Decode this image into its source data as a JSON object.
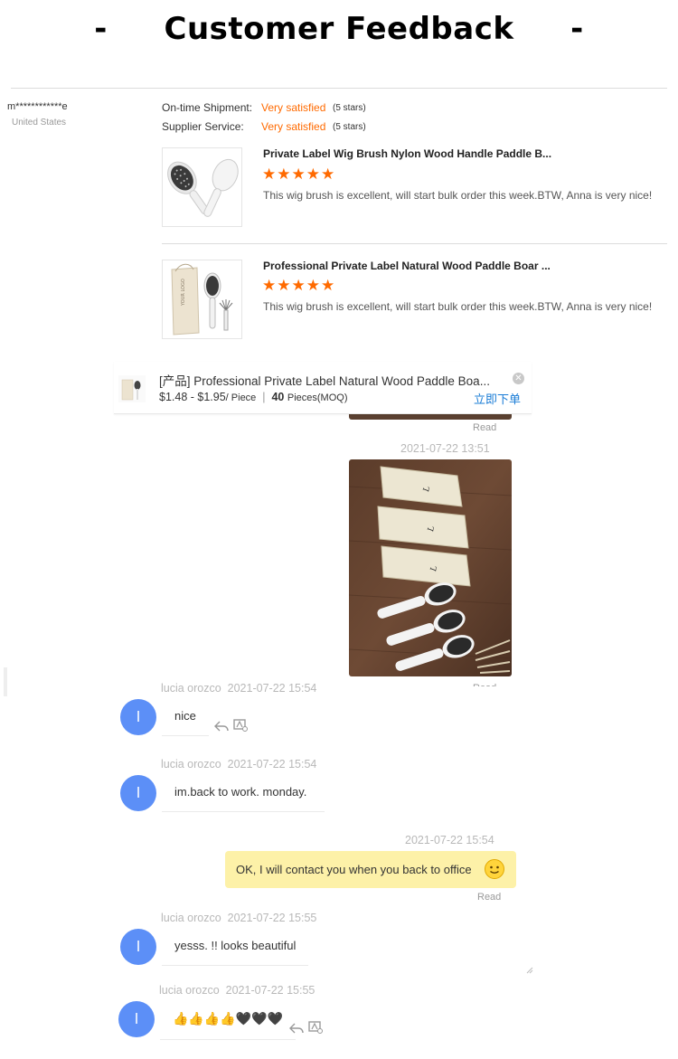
{
  "header": {
    "dash_left": "-",
    "title": "Customer Feedback",
    "dash_right": "-"
  },
  "review": {
    "reviewer_name": "m************e",
    "reviewer_country": "United States",
    "shipment_label": "On-time Shipment:",
    "shipment_value": "Very satisfied",
    "shipment_stars": "(5 stars)",
    "service_label": "Supplier Service:",
    "service_value": "Very satisfied",
    "service_stars": "(5 stars)",
    "products": [
      {
        "title": "Private Label Wig Brush Nylon Wood Handle Paddle B...",
        "stars": "★★★★★",
        "text": "This wig brush is excellent, will start bulk order this week.BTW, Anna is very nice!"
      },
      {
        "title": "Professional Private Label Natural Wood Paddle Boar ...",
        "stars": "★★★★★",
        "text": "This wig brush is excellent, will start bulk order this week.BTW, Anna is very nice!"
      }
    ],
    "logo_text": "YOUR LOGO"
  },
  "chat_bar": {
    "name": "[产品]  Professional Private Label Natural Wood Paddle Boa...",
    "price": "$1.48 - $1.95",
    "price_unit": "/ Piece",
    "sep": "|",
    "moq": "40",
    "moq_unit": "Pieces(MOQ)",
    "order_link": "立即下单",
    "close_icon": "close-icon"
  },
  "chat": {
    "read_1": "Read",
    "ts_1": "2021-07-22 13:51",
    "read_2": "Read",
    "messages": [
      {
        "sender": "lucia orozco",
        "time": "2021-07-22 15:54",
        "avatar": "l",
        "text": "nice"
      },
      {
        "sender": "lucia orozco",
        "time": "2021-07-22 15:54",
        "avatar": "l",
        "text": "im.back to work. monday."
      },
      {
        "time": "2021-07-22 15:54",
        "text": "OK, I will contact you when you back to office",
        "read": "Read"
      },
      {
        "sender": "lucia orozco",
        "time": "2021-07-22 15:55",
        "avatar": "l",
        "text": "yesss. !! looks beautiful"
      },
      {
        "sender": "lucia orozco",
        "time": "2021-07-22 15:55",
        "avatar": "l",
        "text": "👍👍👍👍🖤🖤🖤"
      }
    ]
  },
  "colors": {
    "accent_orange": "#ff6a00",
    "avatar_blue": "#5c8ff7",
    "outgoing_bubble": "#fdf1a8",
    "link_blue": "#1a7cd6"
  }
}
